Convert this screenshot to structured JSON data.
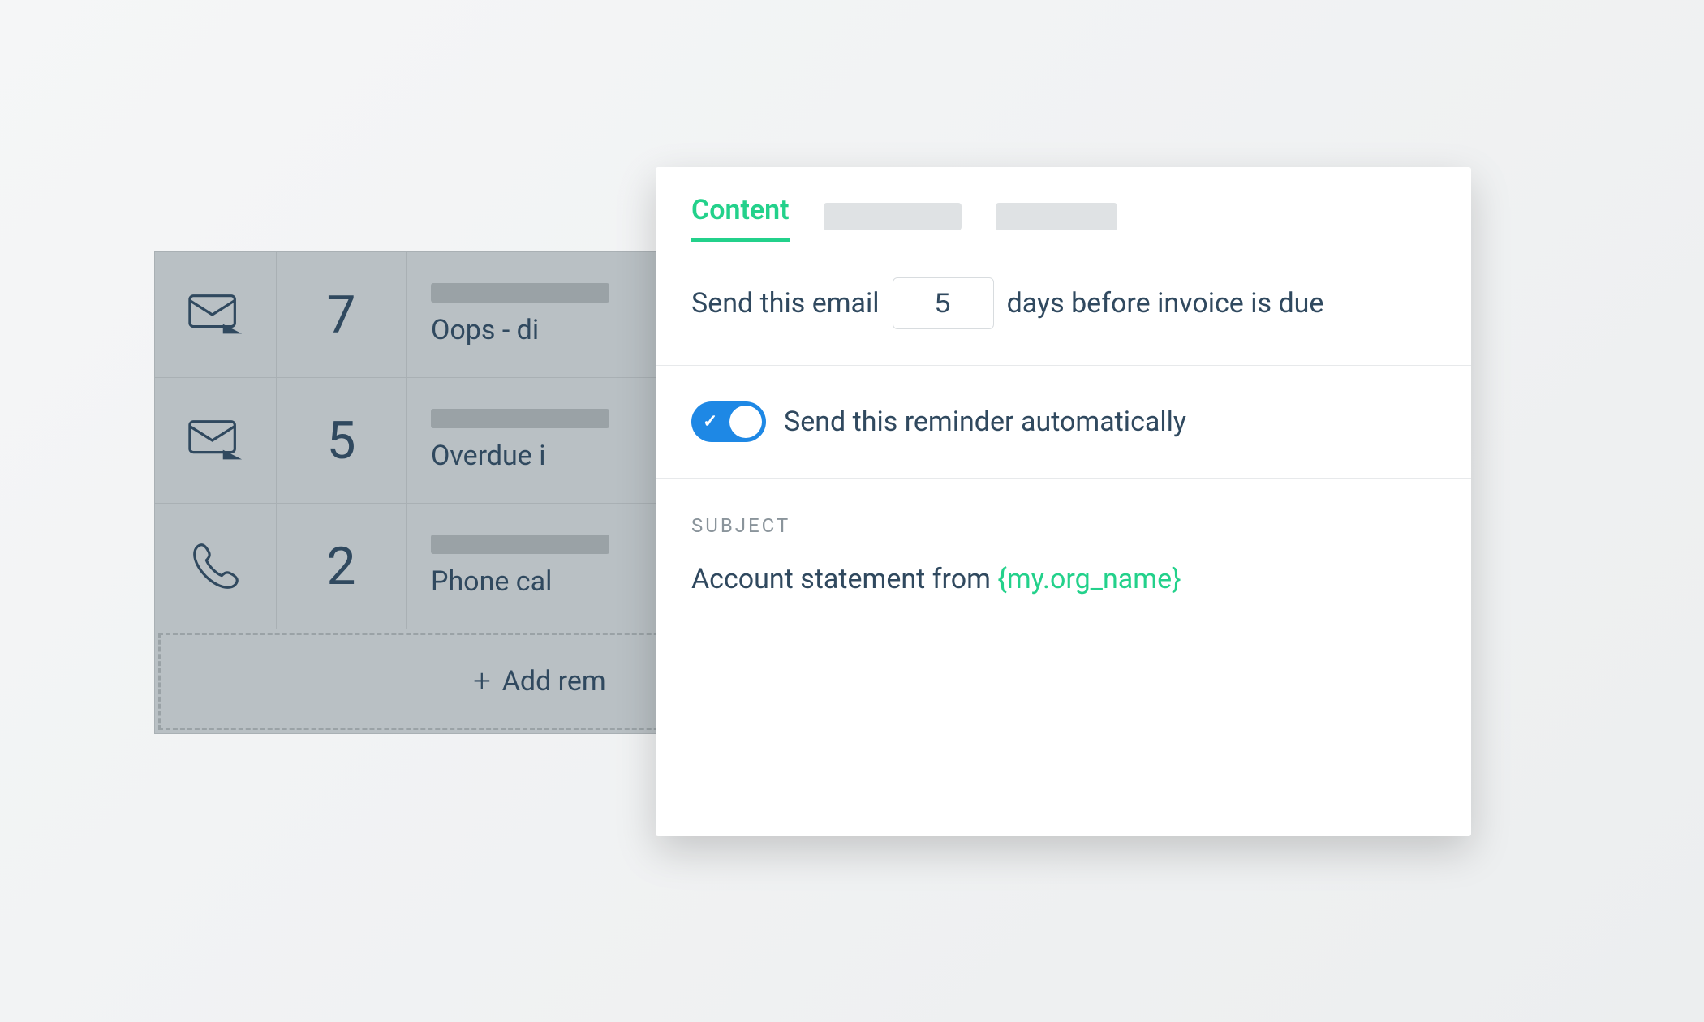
{
  "reminders": [
    {
      "icon": "mail",
      "days": "7",
      "label": "Oops - di"
    },
    {
      "icon": "mail",
      "days": "5",
      "label": "Overdue i"
    },
    {
      "icon": "phone",
      "days": "2",
      "label": "Phone cal"
    }
  ],
  "add_reminder_label": "Add rem",
  "editor": {
    "tabs": {
      "active": "Content"
    },
    "send_line_prefix": "Send this email",
    "send_line_suffix": "days before invoice is due",
    "days_value": "5",
    "auto_toggle_label": "Send this reminder automatically",
    "auto_toggle_on": true,
    "subject_heading": "SUBJECT",
    "subject_text_prefix": "Account statement from ",
    "subject_token": "{my.org_name}"
  }
}
